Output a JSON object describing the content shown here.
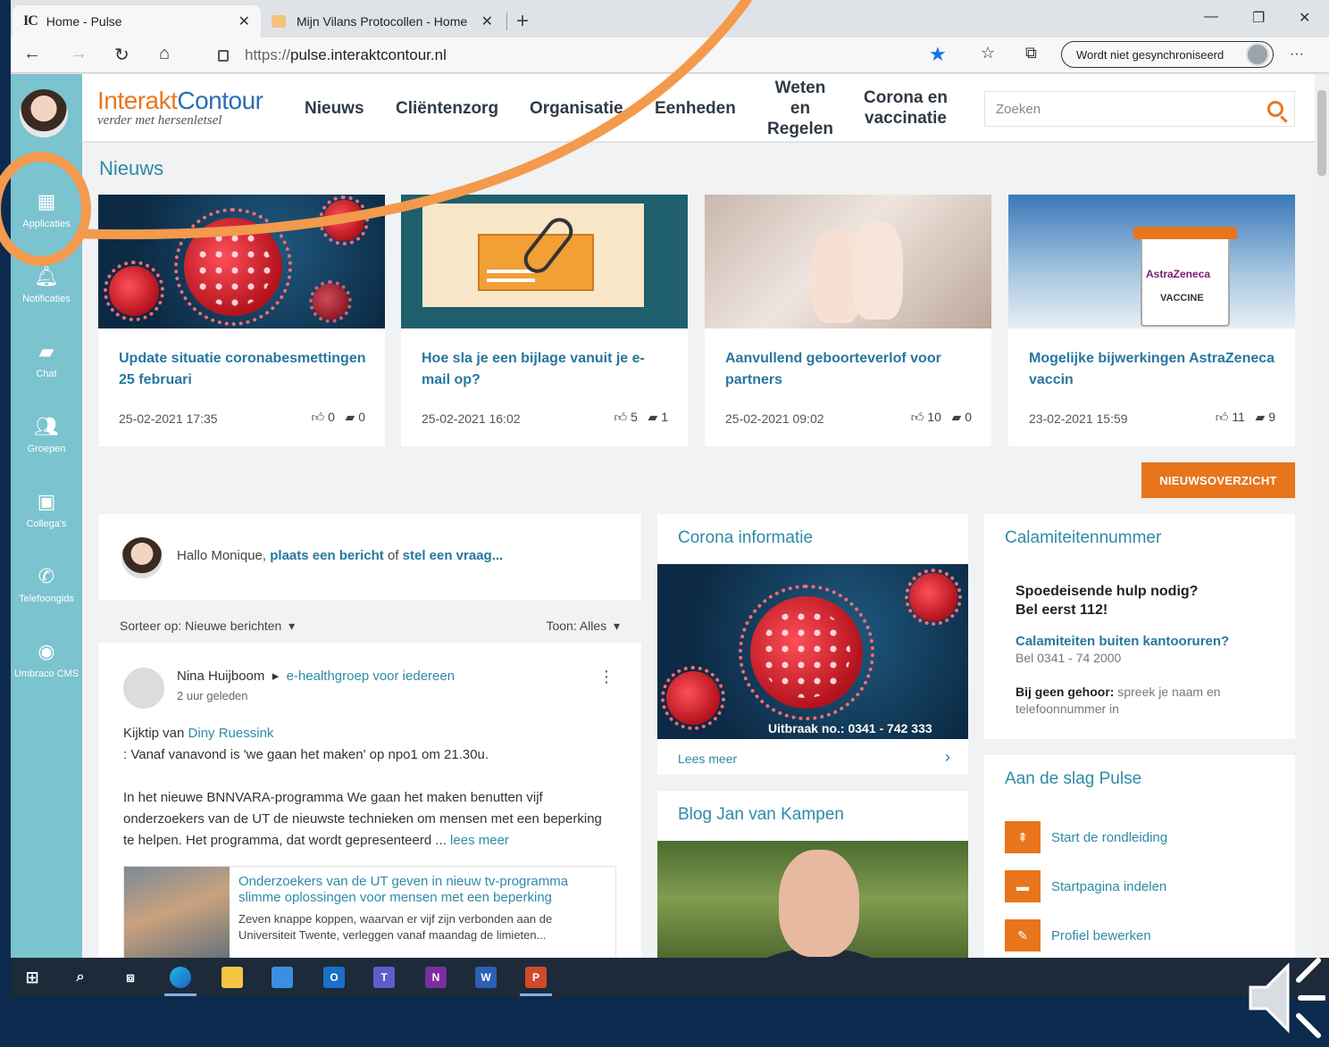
{
  "browser": {
    "tabs": [
      {
        "logo": "IC",
        "label": "Home - Pulse",
        "close": "✕"
      },
      {
        "label": "Mijn Vilans Protocollen - Home",
        "close": "✕"
      }
    ],
    "new_tab": "+",
    "url_protocol": "https://",
    "url_domain": "pulse.interaktcontour.nl",
    "sync_label": "Wordt niet gesynchroniseerd",
    "more": "···"
  },
  "rail": {
    "items": [
      {
        "label": "Applicaties",
        "icon": "grid-icon"
      },
      {
        "label": "Notificaties",
        "icon": "bell-icon"
      },
      {
        "label": "Chat",
        "icon": "chat-icon"
      },
      {
        "label": "Groepen",
        "icon": "group-icon"
      },
      {
        "label": "Collega's",
        "icon": "badge-icon"
      },
      {
        "label": "Telefoongids",
        "icon": "phone-icon"
      },
      {
        "label": "Umbraco CMS",
        "icon": "umbraco-icon"
      }
    ]
  },
  "header": {
    "brand_a": "Interakt",
    "brand_b": "Contour",
    "tagline": "verder met hersenletsel",
    "menu": [
      "Nieuws",
      "Cliëntenzorg",
      "Organisatie",
      "Eenheden",
      "Weten en Regelen",
      "Corona en vaccinatie"
    ],
    "search_placeholder": "Zoeken"
  },
  "news": {
    "title": "Nieuws",
    "items": [
      {
        "title": "Update situatie coronabesmettingen 25 februari",
        "date": "25-02-2021 17:35",
        "likes": "0",
        "comments": "0"
      },
      {
        "title": "Hoe sla je een bijlage vanuit je e-mail op?",
        "date": "25-02-2021 16:02",
        "likes": "5",
        "comments": "1"
      },
      {
        "title": "Aanvullend geboorteverlof voor partners",
        "date": "25-02-2021 09:02",
        "likes": "10",
        "comments": "0"
      },
      {
        "title": "Mogelijke bijwerkingen AstraZeneca vaccin",
        "date": "23-02-2021 15:59",
        "likes": "11",
        "comments": "9"
      }
    ],
    "overview_button": "NIEUWSOVERZICHT",
    "vaccine_label": "AstraZeneca",
    "vaccine_sub": "VACCINE"
  },
  "post": {
    "greeting": "Hallo Monique, ",
    "link1": "plaats een bericht",
    "mid": " of ",
    "link2": "stel een vraag..."
  },
  "sort": {
    "label": "Sorteer op: Nieuwe berichten",
    "filter": "Toon: Alles"
  },
  "feed": {
    "author": "Nina Huijboom",
    "group": "e-healthgroep voor iedereen",
    "ago": "2 uur geleden",
    "line1_pre": "Kijktip van ",
    "line1_link": "Diny Ruessink",
    "line2": ": Vanaf vanavond is 'we gaan het maken' op npo1 om 21.30u.",
    "para": "In het nieuwe BNNVARA-programma We gaan het maken benutten vijf onderzoekers van de UT de nieuwste technieken om mensen met een beperking te helpen. Het programma, dat wordt gepresenteerd ...",
    "more": "lees meer",
    "preview_title": "Onderzoekers van de UT geven in nieuw tv-programma slimme oplossingen voor mensen met een beperking",
    "preview_desc": "Zeven knappe koppen, waarvan er vijf zijn verbonden aan de Universiteit Twente, verleggen vanaf maandag de limieten..."
  },
  "corona": {
    "title": "Corona informatie",
    "outbreak": "Uitbraak no.: 0341 - 742 333",
    "read_more": "Lees meer"
  },
  "blog": {
    "title": "Blog Jan van Kampen"
  },
  "calamity": {
    "title": "Calamiteitennummer",
    "line1": "Spoedeisende hulp nodig?",
    "line2": "Bel eerst 112!",
    "q": "Calamiteiten buiten kantooruren?",
    "number": "Bel 0341 - 74 2000",
    "nog_b": "Bij geen gehoor:",
    "nog": " spreek je naam en telefoonnummer in"
  },
  "start": {
    "title": "Aan de slag Pulse",
    "items": [
      "Start de rondleiding",
      "Startpagina indelen",
      "Profiel bewerken"
    ]
  },
  "colors": {
    "orange": "#e8751c",
    "teal": "#2e8aa8",
    "rail": "#7bc3cf"
  }
}
